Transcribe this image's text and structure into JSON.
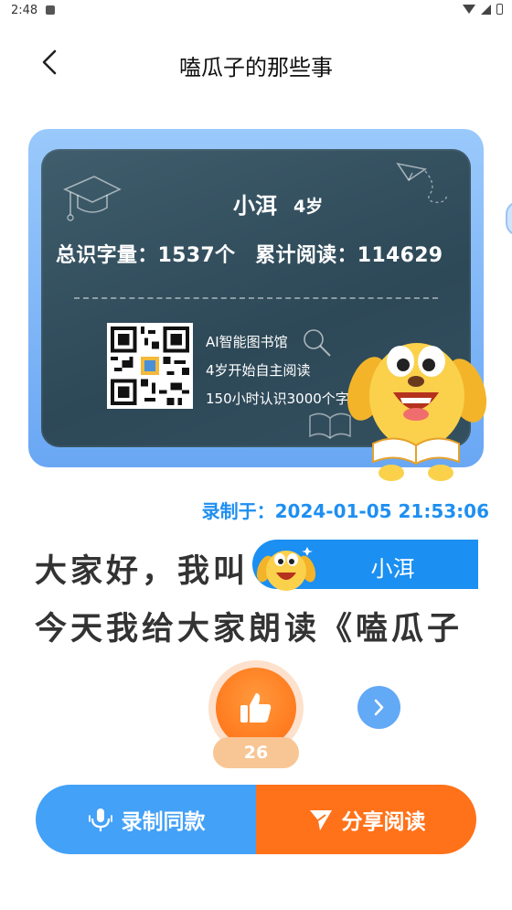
{
  "status_bar": {
    "time": "2:48"
  },
  "header": {
    "title": "嗑瓜子的那些事"
  },
  "card": {
    "reader_name": "小洱",
    "reader_age": "4岁",
    "stats": {
      "chars_label": "总识字量：",
      "chars_value": "1537个",
      "reads_label": "累计阅读：",
      "reads_value": "114629"
    },
    "promo_lines": [
      "AI智能图书馆",
      "4岁开始自主阅读",
      "150小时认识3000个字"
    ]
  },
  "record_time": "录制于：2024-01-05 21:53:06",
  "content": {
    "line1": "大家好，我叫",
    "name_badge": "小洱",
    "line2": "今天我给大家朗读《嗑瓜子"
  },
  "like": {
    "count": "26"
  },
  "actions": {
    "record_same": "录制同款",
    "share_read": "分享阅读"
  },
  "colors": {
    "primary_blue": "#43a1f7",
    "accent_orange": "#ff7219",
    "timestamp_blue": "#1e8ff1"
  }
}
